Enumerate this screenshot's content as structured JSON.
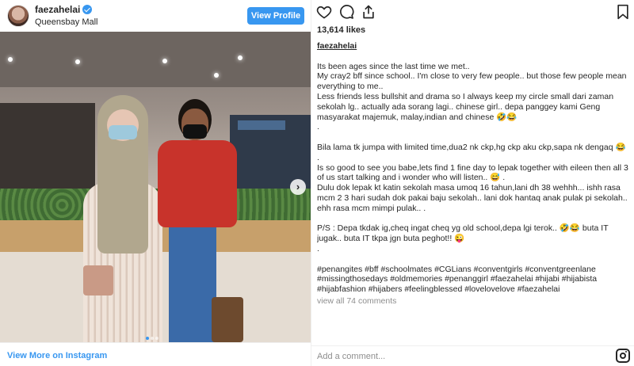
{
  "header": {
    "username": "faezahelai",
    "location": "Queensbay Mall",
    "view_profile_label": "View Profile"
  },
  "footer": {
    "view_more_label": "View More on Instagram"
  },
  "post": {
    "likes": "13,614 likes",
    "author": "faezahelai",
    "caption_lines": [
      "Its been ages since the last time we met..",
      "My cray2 bff since school.. I'm close to very few people.. but those few people mean everything to me..",
      "Less friends less bullshit and drama so I always keep my circle small dari zaman sekolah lg.. actually ada sorang lagi.. chinese girl.. depa panggey kami Geng masyarakat majemuk, malay,indian and chinese 🤣😂",
      ".",
      "",
      "Bila lama tk jumpa with limited time,dua2 nk ckp,hg ckp aku ckp,sapa nk dengaq 😂",
      ".",
      "Is so good to see you babe,lets find 1 fine day to lepak together with eileen then all 3 of us start talking and i wonder who will listen.. 😅 .",
      "Dulu dok lepak kt katin sekolah masa umoq 16 tahun,lani dh 38 wehhh... ishh rasa mcm 2 3 hari sudah dok pakai baju sekolah.. lani dok hantaq anak pulak pi sekolah.. ehh rasa mcm mimpi pulak.. .",
      "",
      "P/S : Depa tkdak ig,cheq ingat cheq yg old school,depa lgi terok.. 🤣😂 buta IT jugak.. buta IT tkpa jgn buta peghot!! 😜",
      ".",
      "",
      "#penangites #bff #schoolmates #CGLians #conventgirls #conventgreenlane #missingthosedays #oldmemories #penanggirl #faezahelai #hijabi #hijabista #hijabfashion #hijabers #feelingblessed #lovelovelove #faezahelai"
    ],
    "view_comments": "view all 74 comments",
    "comment_placeholder": "Add a comment..."
  },
  "icons": {
    "like": "heart-icon",
    "comment": "comment-icon",
    "share": "share-icon",
    "save": "bookmark-icon",
    "logo": "instagram-icon",
    "next": "chevron-right-icon"
  },
  "colors": {
    "accent": "#3897f0",
    "text": "#262626",
    "muted": "#8e8e8e"
  }
}
